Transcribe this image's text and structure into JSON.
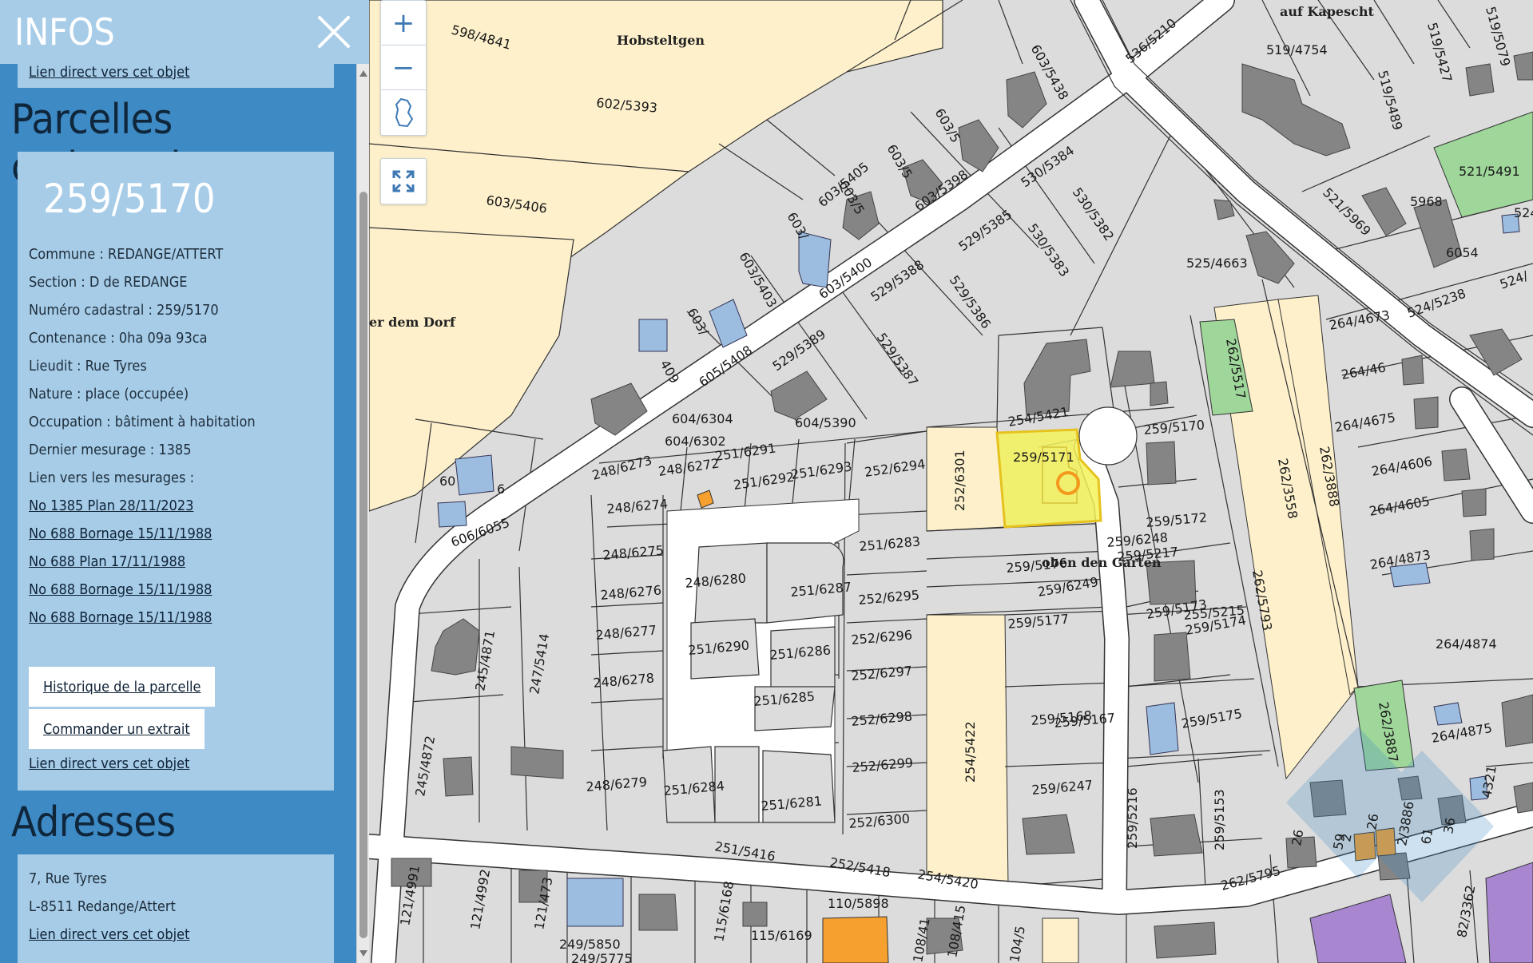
{
  "panel": {
    "title": "INFOS",
    "top_link": "Lien direct vers cet objet",
    "parcels": {
      "section_title": "Parcelles cadastrales",
      "parcel_number": "259/5170",
      "lines": [
        "Commune : REDANGE/ATTERT",
        "Section : D de REDANGE",
        "Numéro cadastral : 259/5170",
        "Contenance : 0ha 09a 93ca",
        "Lieudit : Rue Tyres",
        "Nature : place (occupée)",
        "Occupation : bâtiment à habitation",
        "Dernier mesurage : 1385",
        "Lien vers les mesurages :"
      ],
      "measurement_links": [
        "No 1385 Plan 28/11/2023",
        "No 688 Bornage 15/11/1988",
        "No 688 Plan 17/11/1988",
        "No 688 Bornage 15/11/1988",
        "No 688 Bornage 15/11/1988"
      ],
      "history_button": "Historique de la parcelle",
      "extract_button": "Commander un extrait",
      "direct_link": "Lien direct vers cet objet"
    },
    "addresses": {
      "section_title": "Adresses",
      "street": "7, Rue Tyres",
      "city": "L-8511 Redange/Attert",
      "direct_link": "Lien direct vers cet objet"
    }
  },
  "map_controls": {
    "zoom_in": "+",
    "zoom_out": "−",
    "icons": [
      "plus-icon",
      "minus-icon",
      "country-outline-icon",
      "fullscreen-icon"
    ]
  },
  "map": {
    "place_names": [
      "Hobsteltgen",
      "auf Kapescht",
      "er dem Dorf",
      "oben den Garten"
    ],
    "parcel_labels": [
      "598/4841",
      "602/5393",
      "603/5406",
      "603/5438",
      "603/5",
      "603/5",
      "603/5",
      "603/",
      "603/5403",
      "603/5405",
      "603/5400",
      "603/5398",
      "536/5210",
      "519/4754",
      "519/5427",
      "519/5489",
      "519/5079",
      "521/5491",
      "5968",
      "521/5969",
      "524",
      "6054",
      "524/5238",
      "524/",
      "530/5384",
      "530/5382",
      "530/5383",
      "529/5385",
      "529/5386",
      "529/5388",
      "529/5387",
      "529/5389",
      "525/4663",
      "605/5408",
      "603/",
      "409",
      "604/6304",
      "604/6302",
      "604/5390",
      "606/6055",
      "60",
      "6",
      "248/6273",
      "248/6272",
      "251/6291",
      "251/6292",
      "251/6293",
      "252/6294",
      "248/6274",
      "248/6275",
      "248/6276",
      "248/6277",
      "248/6278",
      "248/6279",
      "248/6280",
      "251/6287",
      "251/6290",
      "251/6286",
      "251/6285",
      "251/6284",
      "251/6281",
      "251/6283",
      "252/6295",
      "252/6296",
      "252/6297",
      "252/6298",
      "252/6299",
      "252/6300",
      "252/6301",
      "254/5422",
      "254/5421",
      "259/5171",
      "259/5170",
      "259/5172",
      "259/5173",
      "259/5174",
      "259/5175",
      "259/5176",
      "259/5177",
      "259/5168",
      "259/5167",
      "259/6247",
      "259/6248",
      "259/6249",
      "259/5217",
      "255/5215",
      "259/5216",
      "259/5153",
      "262/5517",
      "262/3558",
      "262/3888",
      "262/5793",
      "262/3887",
      "262/5795",
      "264/4673",
      "264/46",
      "264/4675",
      "264/4606",
      "264/4605",
      "264/4873",
      "264/4874",
      "264/4875",
      "245/4871",
      "247/5414",
      "245/4872",
      "251/5416",
      "252/5418",
      "254/5420",
      "121/4991",
      "121/4992",
      "121/473",
      "249/5850",
      "249/5775",
      "115/6168",
      "115/6169",
      "110/5898",
      "108/41",
      "108/415",
      "104/5",
      "82/3362",
      "4321",
      "2/3886",
      "26",
      "59",
      "61",
      "36",
      "2",
      "26",
      "262/579"
    ],
    "colors": {
      "selected_parcel": "#f4f25a",
      "selected_outline": "#e6c21e",
      "selected_marker": "#f39a1d",
      "field": "#fdf0cb",
      "green_parcel": "#9fd69a",
      "blue_building": "#9cbddf",
      "orange_building": "#f6a12f",
      "purple_building": "#a886d0",
      "gray_building": "#858585",
      "road": "#ffffff",
      "ground": "#dcdcdc"
    }
  }
}
